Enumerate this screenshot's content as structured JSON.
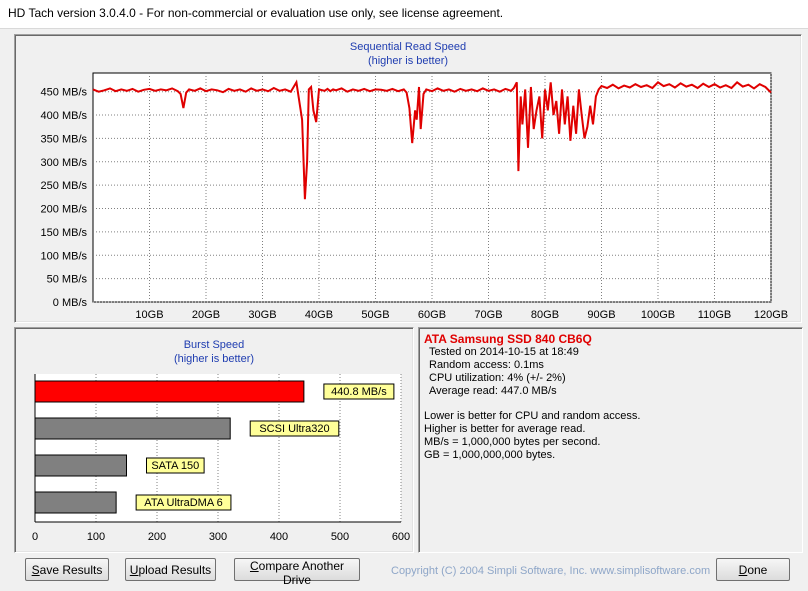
{
  "window": {
    "title": "HD Tach version 3.0.4.0  - For non-commercial or evaluation use only, see license agreement."
  },
  "chart_data": [
    {
      "type": "line",
      "title": "Sequential Read Speed",
      "subtitle": "(higher is better)",
      "x_ticks": [
        "10GB",
        "20GB",
        "30GB",
        "40GB",
        "50GB",
        "60GB",
        "70GB",
        "80GB",
        "90GB",
        "100GB",
        "110GB",
        "120GB"
      ],
      "y_ticks": [
        "0 MB/s",
        "50 MB/s",
        "100 MB/s",
        "150 MB/s",
        "200 MB/s",
        "250 MB/s",
        "300 MB/s",
        "350 MB/s",
        "400 MB/s",
        "450 MB/s"
      ],
      "xlim": [
        0,
        120
      ],
      "ylim": [
        0,
        490
      ],
      "grid": true,
      "color": "#e00000",
      "series": [
        {
          "x": [
            0,
            1,
            2,
            3,
            4,
            5,
            6,
            7,
            8,
            9,
            10,
            11,
            12,
            13,
            14,
            15,
            15.5,
            16,
            16.5,
            17,
            18,
            19,
            20,
            21,
            22,
            23,
            24,
            25,
            26,
            27,
            28,
            29,
            30,
            31,
            32,
            33,
            34,
            35,
            36,
            37,
            37.5,
            37.9,
            38.2,
            38.6,
            39,
            39.5,
            40,
            41,
            41.5,
            42,
            42.5,
            43,
            44,
            45,
            46,
            47,
            48,
            49,
            50,
            51,
            52,
            53,
            54,
            55,
            55.5,
            56,
            56.5,
            57,
            57.3,
            57.7,
            58,
            58.5,
            59,
            60,
            61,
            62,
            63,
            64,
            65,
            66,
            67,
            68,
            69,
            70,
            71,
            72,
            73,
            74,
            74.5,
            75,
            75.3,
            75.7,
            76,
            76.5,
            77,
            77.5,
            78,
            78.5,
            79,
            79.5,
            80,
            80.5,
            81,
            81.5,
            82,
            82.5,
            83,
            83.5,
            84,
            84.5,
            85,
            85.5,
            86,
            86.5,
            87,
            87.5,
            88,
            88.5,
            89,
            89.5,
            90,
            91,
            92,
            93,
            94,
            95,
            96,
            97,
            98,
            99,
            100,
            101,
            102,
            103,
            104,
            105,
            106,
            107,
            108,
            109,
            110,
            111,
            112,
            113,
            114,
            115,
            116,
            117,
            118,
            119,
            120
          ],
          "y": [
            455,
            450,
            453,
            457,
            451,
            455,
            452,
            456,
            450,
            454,
            456,
            452,
            455,
            453,
            457,
            451,
            445,
            415,
            448,
            455,
            452,
            457,
            451,
            455,
            453,
            449,
            456,
            452,
            455,
            450,
            457,
            452,
            455,
            451,
            458,
            452,
            455,
            450,
            470,
            390,
            220,
            300,
            455,
            460,
            410,
            385,
            455,
            452,
            456,
            451,
            455,
            453,
            457,
            450,
            455,
            452,
            456,
            451,
            455,
            454,
            452,
            456,
            451,
            455,
            448,
            415,
            340,
            410,
            390,
            460,
            370,
            445,
            455,
            451,
            457,
            452,
            455,
            450,
            456,
            452,
            455,
            451,
            457,
            452,
            455,
            450,
            456,
            452,
            458,
            470,
            280,
            440,
            380,
            455,
            330,
            460,
            370,
            410,
            440,
            350,
            455,
            410,
            470,
            400,
            430,
            360,
            455,
            380,
            440,
            345,
            420,
            360,
            455,
            400,
            350,
            375,
            420,
            380,
            440,
            455,
            462,
            458,
            465,
            457,
            463,
            459,
            466,
            460,
            464,
            458,
            470,
            462,
            466,
            459,
            468,
            461,
            465,
            458,
            467,
            460,
            466,
            459,
            464,
            458,
            470,
            461,
            465,
            457,
            466,
            460,
            448
          ]
        }
      ]
    },
    {
      "type": "bar",
      "orientation": "horizontal",
      "title": "Burst Speed",
      "subtitle": "(higher is better)",
      "categories": [
        "440.8 MB/s",
        "SCSI Ultra320",
        "SATA 150",
        "ATA UltraDMA 6"
      ],
      "values": [
        440.8,
        320,
        150,
        133
      ],
      "colors": [
        "#ff0000",
        "#808080",
        "#808080",
        "#808080"
      ],
      "x_ticks": [
        "0",
        "100",
        "200",
        "300",
        "400",
        "500",
        "600"
      ],
      "xlim": [
        0,
        600
      ],
      "grid": true
    }
  ],
  "info": {
    "drive_name": "ATA Samsung SSD 840 CB6Q",
    "tested_on": "Tested on 2014-10-15 at 18:49",
    "random_access": "Random access: 0.1ms",
    "cpu": "CPU utilization: 4% (+/- 2%)",
    "avg_read": "Average read: 447.0 MB/s",
    "note1": "Lower is better for CPU and random access.",
    "note2": "Higher is better for average read.",
    "note3": "MB/s = 1,000,000 bytes per second.",
    "note4": "GB = 1,000,000,000 bytes."
  },
  "buttons": {
    "save": {
      "first": "S",
      "rest": "ave Results"
    },
    "upload": {
      "first": "U",
      "rest": "pload Results"
    },
    "compare": {
      "first": "C",
      "rest": "ompare Another Drive"
    },
    "done": {
      "first": "D",
      "rest": "one"
    }
  },
  "copyright": "Copyright (C) 2004 Simpli Software, Inc. www.simplisoftware.com"
}
